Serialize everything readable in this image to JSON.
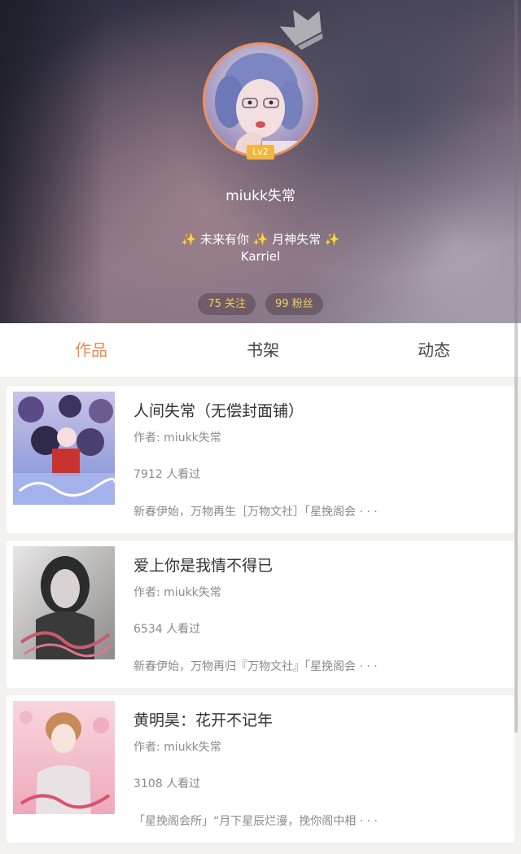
{
  "profile": {
    "level": "Lv2",
    "username": "miukk失常",
    "bio_line1": "✨ 未来有你 ✨ 月神失常 ✨",
    "bio_line2": "Karriel",
    "following": "75 关注",
    "followers": "99 粉丝"
  },
  "tabs": [
    {
      "label": "作品",
      "active": true
    },
    {
      "label": "书架",
      "active": false
    },
    {
      "label": "动态",
      "active": false
    }
  ],
  "works": [
    {
      "title": "人间失常（无偿封面铺）",
      "author": "作者: miukk失常",
      "views": "7912 人看过",
      "desc": "新春伊始，万物再生［万物文社］「星挽阁会 · · ·",
      "cover_theme": "blue-collage"
    },
    {
      "title": "爱上你是我情不得已",
      "author": "作者: miukk失常",
      "views": "6534 人看过",
      "desc": "新春伊始，万物再归『万物文社』「星挽阁会 · · ·",
      "cover_theme": "mono-portrait"
    },
    {
      "title": "黄明昊：花开不记年",
      "author": "作者: miukk失常",
      "views": "3108 人看过",
      "desc": "「星挽阁会所」“月下星辰烂漫，挽你阁中相 · · ·",
      "cover_theme": "pink-portrait"
    }
  ],
  "colors": {
    "accent": "#ee8a4f",
    "avatar_ring": "#ee8f5c",
    "level_badge": "#f1b73d",
    "stat_text": "#f5cc5a"
  },
  "icons": {
    "crown": "crown-icon",
    "avatar": "user-avatar"
  }
}
